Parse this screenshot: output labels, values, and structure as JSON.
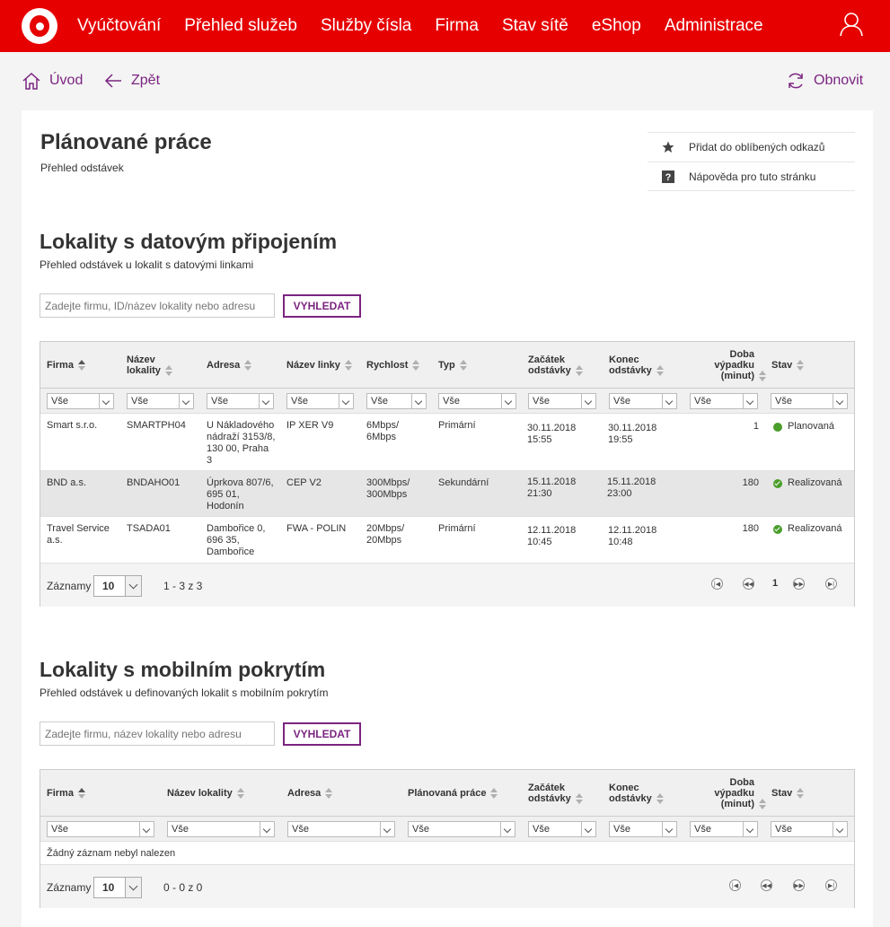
{
  "nav": {
    "items": [
      "Vyúčtování",
      "Přehled služeb",
      "Služby čísla",
      "Firma",
      "Stav sítě",
      "eShop",
      "Administrace"
    ]
  },
  "subnav": {
    "home": "Úvod",
    "back": "Zpět",
    "refresh": "Obnovit"
  },
  "page": {
    "title": "Plánované práce",
    "subtitle": "Přehled odstávek"
  },
  "quick_links": {
    "favorite": "Přidat do oblíbených odkazů",
    "help": "Nápověda pro tuto stránku"
  },
  "data_section": {
    "title": "Lokality s datovým připojením",
    "subtitle": "Přehled odstávek u lokalit s datovými linkami",
    "search_placeholder": "Zadejte firmu, ID/název lokality nebo adresu",
    "search_button": "VYHLEDAT",
    "columns": {
      "firma": "Firma",
      "nazev1": "Název",
      "nazev2": "lokality",
      "adresa": "Adresa",
      "linka": "Název linky",
      "rychlost": "Rychlost",
      "typ": "Typ",
      "zacatek1": "Začátek",
      "zacatek2": "odstávky",
      "konec1": "Konec",
      "konec2": "odstávky",
      "doba1": "Doba",
      "doba2": "výpadku",
      "doba3": "(minut)",
      "stav": "Stav"
    },
    "filter_value": "Vše",
    "rows": [
      {
        "firma": [
          "Smart s.r.o."
        ],
        "lokalita": "SMARTPH04",
        "adresa": [
          "U Nákladového",
          "nádraží 3153/8,",
          "130 00, Praha",
          "3"
        ],
        "linka": "IP XER V9",
        "rychlost": [
          "6Mbps/",
          "6Mbps"
        ],
        "typ": "Primární",
        "zacatek": [
          "30.11.2018",
          "15:55"
        ],
        "konec": [
          "30.11.2018",
          "19:55"
        ],
        "doba": "1",
        "stav": "Planovaná",
        "stav_icon": "dot"
      },
      {
        "firma": [
          "BND a.s."
        ],
        "lokalita": "BNDAHO01",
        "adresa": [
          "Úprkova 807/6,",
          "695 01,",
          "Hodonín"
        ],
        "linka": "CEP V2",
        "rychlost": [
          "300Mbps/",
          "300Mbps"
        ],
        "typ": "Sekundární",
        "zacatek": [
          "15.11.2018",
          "21:30"
        ],
        "konec": [
          "15.11.2018",
          "23:00"
        ],
        "doba": "180",
        "stav": "Realizovaná",
        "stav_icon": "check"
      },
      {
        "firma": [
          "Travel Service",
          "a.s."
        ],
        "lokalita": "TSADA01",
        "adresa": [
          "Dambořice 0,",
          "696 35,",
          "Dambořice"
        ],
        "linka": "FWA - POLIN",
        "rychlost": [
          "20Mbps/",
          "20Mbps"
        ],
        "typ": "Primární",
        "zacatek": [
          "12.11.2018",
          "10:45"
        ],
        "konec": [
          "12.11.2018",
          "10:48"
        ],
        "doba": "180",
        "stav": "Realizovaná",
        "stav_icon": "check"
      }
    ],
    "footer": {
      "label": "Záznamy",
      "page_size": "10",
      "range": "1 - 3 z 3",
      "current_page": "1"
    }
  },
  "mobile_section": {
    "title": "Lokality s mobilním pokrytím",
    "subtitle": "Přehled odstávek u definovaných lokalit s mobilním pokrytím",
    "search_placeholder": "Zadejte firmu, název lokality nebo adresu",
    "search_button": "VYHLEDAT",
    "columns": {
      "firma": "Firma",
      "nazev": "Název lokality",
      "adresa": "Adresa",
      "prace": "Plánovaná práce",
      "zacatek1": "Začátek",
      "zacatek2": "odstávky",
      "konec1": "Konec",
      "konec2": "odstávky",
      "doba1": "Doba",
      "doba2": "výpadku",
      "doba3": "(minut)",
      "stav": "Stav"
    },
    "filter_value": "Vše",
    "empty_text": "Žádný záznam nebyl nalezen",
    "footer": {
      "label": "Záznamy",
      "page_size": "10",
      "range": "0 - 0 z 0"
    }
  },
  "colors": {
    "brand_red": "#e60000",
    "accent_purple": "#7b2480",
    "status_green": "#4a9e2b"
  }
}
